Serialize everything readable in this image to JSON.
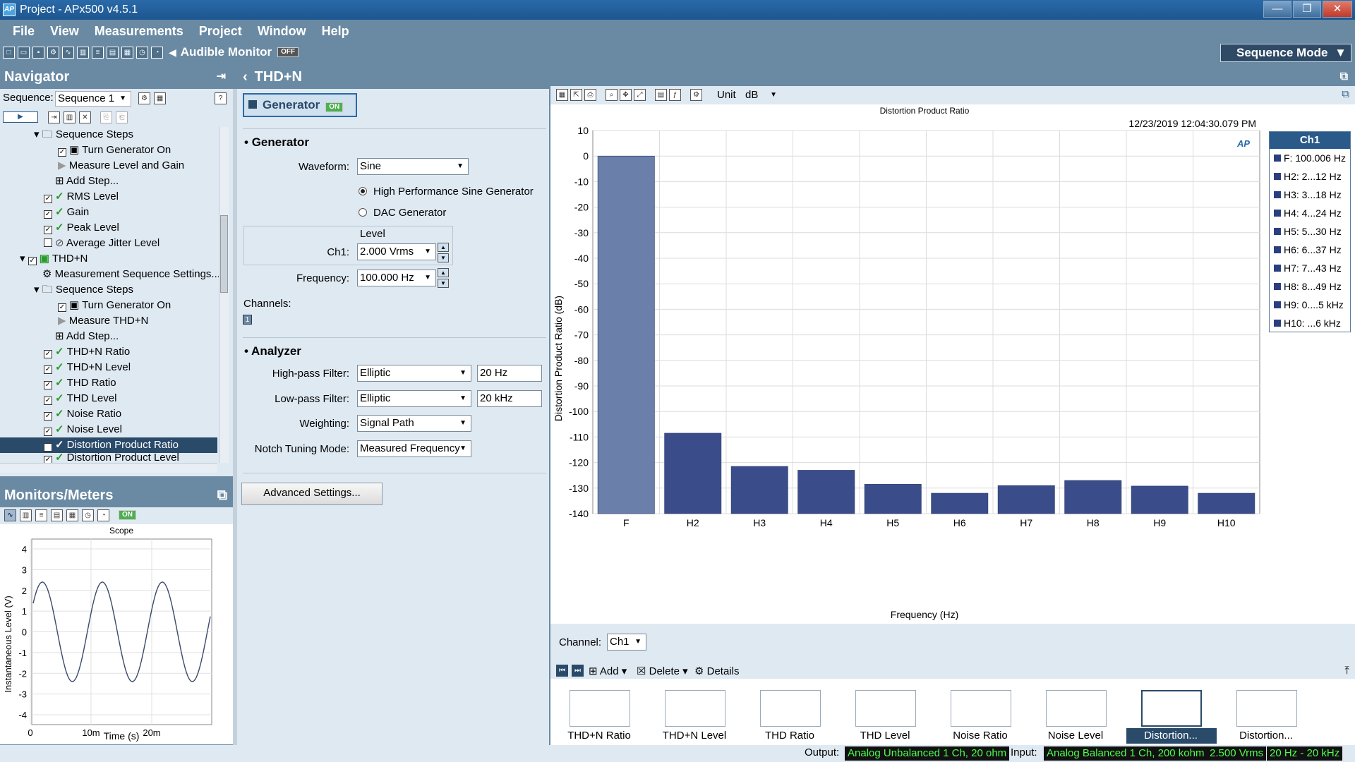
{
  "window": {
    "title": "Project - APx500 v4.5.1"
  },
  "menu": [
    "File",
    "View",
    "Measurements",
    "Project",
    "Window",
    "Help"
  ],
  "toolbar": {
    "audible_monitor": "Audible Monitor",
    "audible_state": "OFF",
    "sequence_mode": "Sequence Mode"
  },
  "navigator": {
    "title": "Navigator",
    "sequence_label": "Sequence:",
    "sequence_value": "Sequence 1",
    "items": [
      {
        "label": "Sequence Steps"
      },
      {
        "label": "Turn Generator On"
      },
      {
        "label": "Measure Level and Gain"
      },
      {
        "label": "Add Step..."
      },
      {
        "label": "RMS Level"
      },
      {
        "label": "Gain"
      },
      {
        "label": "Peak Level"
      },
      {
        "label": "Average Jitter Level"
      },
      {
        "label": "THD+N"
      },
      {
        "label": "Measurement Sequence Settings..."
      },
      {
        "label": "Sequence Steps"
      },
      {
        "label": "Turn Generator On"
      },
      {
        "label": "Measure THD+N"
      },
      {
        "label": "Add Step..."
      },
      {
        "label": "THD+N Ratio"
      },
      {
        "label": "THD+N Level"
      },
      {
        "label": "THD Ratio"
      },
      {
        "label": "THD Level"
      },
      {
        "label": "Noise Ratio"
      },
      {
        "label": "Noise Level"
      },
      {
        "label": "Distortion Product Ratio"
      },
      {
        "label": "Distortion Product Level"
      }
    ]
  },
  "monitors": {
    "title": "Monitors/Meters",
    "state": "ON",
    "scope": {
      "title": "Scope",
      "ylabel": "Instantaneous Level (V)",
      "xlabel": "Time (s)",
      "yticks": [
        "4",
        "3",
        "2",
        "1",
        "0",
        "-1",
        "-2",
        "-3",
        "-4"
      ],
      "xticks": [
        "0",
        "10m",
        "20m"
      ]
    }
  },
  "page": {
    "title": "THD+N"
  },
  "generator": {
    "button_label": "Generator",
    "state": "ON",
    "section_title": "Generator",
    "waveform_label": "Waveform:",
    "waveform_value": "Sine",
    "radio1": "High Performance Sine Generator",
    "radio2": "DAC Generator",
    "level_title": "Level",
    "ch1_label": "Ch1:",
    "ch1_value": "2.000 Vrms",
    "freq_label": "Frequency:",
    "freq_value": "100.000 Hz",
    "channels_label": "Channels:",
    "channel_badge": "1"
  },
  "analyzer": {
    "section_title": "Analyzer",
    "hp_label": "High-pass Filter:",
    "hp_value": "Elliptic",
    "hp_freq": "20 Hz",
    "lp_label": "Low-pass Filter:",
    "lp_value": "Elliptic",
    "lp_freq": "20 kHz",
    "weighting_label": "Weighting:",
    "weighting_value": "Signal Path",
    "notch_label": "Notch Tuning Mode:",
    "notch_value": "Measured Frequency",
    "advanced_button": "Advanced Settings..."
  },
  "graph_toolbar": {
    "unit_label": "Unit",
    "unit_value": "dB"
  },
  "chart_data": {
    "type": "bar",
    "title": "Distortion Product Ratio",
    "timestamp": "12/23/2019 12:04:30.079 PM",
    "xlabel": "Frequency (Hz)",
    "ylabel": "Distortion Product Ratio (dB)",
    "ylim": [
      -140,
      10
    ],
    "yticks": [
      10,
      0,
      -10,
      -20,
      -30,
      -40,
      -50,
      -60,
      -70,
      -80,
      -90,
      -100,
      -110,
      -120,
      -130,
      -140
    ],
    "categories": [
      "F",
      "H2",
      "H3",
      "H4",
      "H5",
      "H6",
      "H7",
      "H8",
      "H9",
      "H10"
    ],
    "series": [
      {
        "name": "Ch1",
        "values": [
          0,
          -108.5,
          -121.5,
          -123,
          -128.5,
          -132,
          -129,
          -127,
          -129.2,
          -132
        ]
      }
    ],
    "colors": {
      "fundamental": "#6b7fab",
      "harmonics": "#3a4d8a"
    },
    "legend": {
      "title": "Ch1",
      "entries": [
        "F: 100.006 Hz",
        "H2: 2...12 Hz",
        "H3: 3...18 Hz",
        "H4: 4...24 Hz",
        "H5: 5...30 Hz",
        "H6: 6...37 Hz",
        "H7: 7...43 Hz",
        "H8: 8...49 Hz",
        "H9: 0....5 kHz",
        "H10: ...6 kHz"
      ]
    }
  },
  "channel": {
    "label": "Channel:",
    "value": "Ch1"
  },
  "thumbbar": {
    "add": "Add",
    "delete": "Delete",
    "details": "Details"
  },
  "thumbnails": [
    "THD+N Ratio",
    "THD+N Level",
    "THD Ratio",
    "THD Level",
    "Noise Ratio",
    "Noise Level",
    "Distortion...",
    "Distortion..."
  ],
  "status": {
    "output_label": "Output:",
    "output_value": "Analog Unbalanced 1 Ch, 20 ohm",
    "input_label": "Input:",
    "input_value": "Analog Balanced 1 Ch, 200 kohm",
    "level": "2.500 Vrms",
    "range": "20 Hz - 20 kHz"
  }
}
